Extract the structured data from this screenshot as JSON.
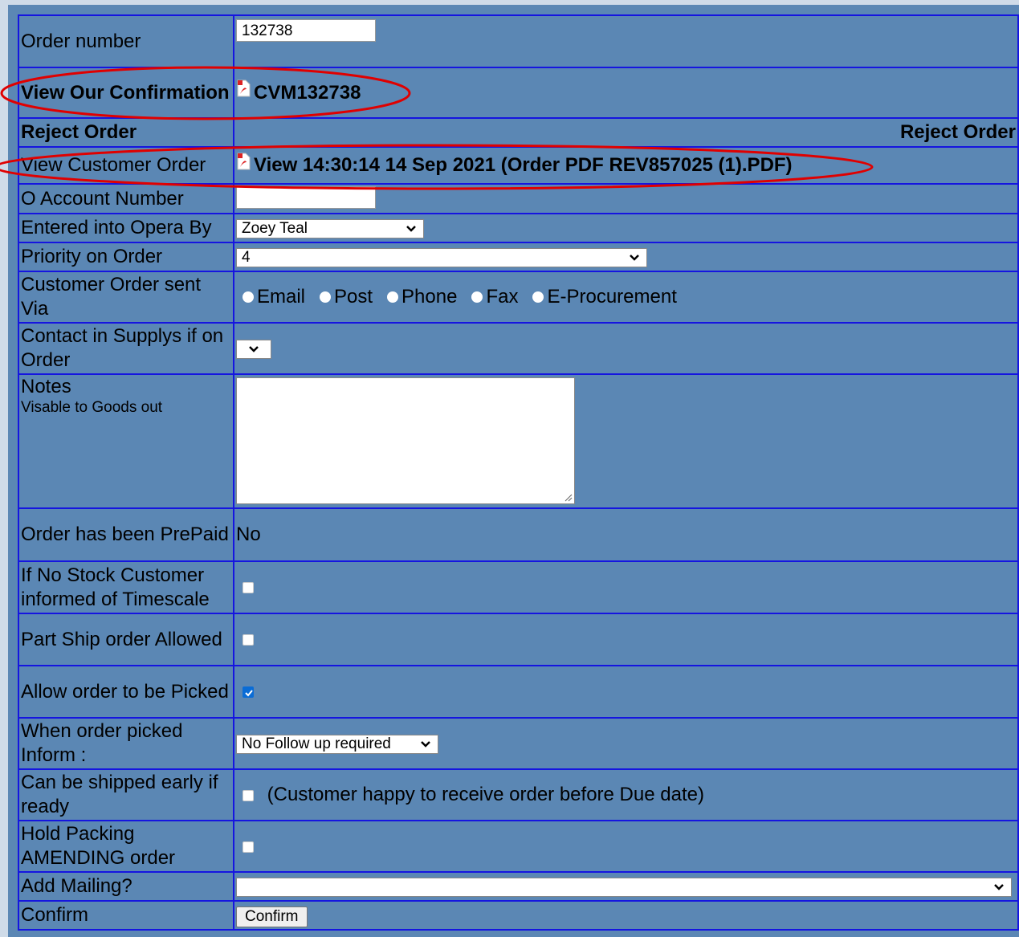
{
  "colors": {
    "panel_bg": "#5b87b4",
    "border": "#1515e0",
    "annotation": "#e00000",
    "checkbox_checked": "#0a6cd6"
  },
  "order_number": {
    "label": "Order number",
    "value": "132738"
  },
  "view_confirmation": {
    "label": "View Our Confirmation",
    "link_text": "CVM132738",
    "icon": "pdf-icon"
  },
  "reject_order": {
    "label": "Reject Order",
    "link_text": "Reject Order"
  },
  "view_customer_order": {
    "label": "View Customer Order",
    "link_text": "View 14:30:14 14 Sep 2021 (Order PDF REV857025 (1).PDF)",
    "icon": "pdf-icon"
  },
  "o_account_number": {
    "label": "O Account Number",
    "value": ""
  },
  "entered_by": {
    "label": "Entered into Opera By",
    "selected": "Zoey Teal"
  },
  "priority": {
    "label": "Priority on Order",
    "selected": "4"
  },
  "sent_via": {
    "label": "Customer Order sent Via",
    "options": [
      "Email",
      "Post",
      "Phone",
      "Fax",
      "E-Procurement"
    ]
  },
  "contact_in_supplys": {
    "label": "Contact in Supplys if on Order",
    "selected": ""
  },
  "notes": {
    "label": "Notes",
    "sublabel": "Visable to Goods out",
    "value": ""
  },
  "prepaid": {
    "label": "Order has been PrePaid",
    "value": "No"
  },
  "no_stock_informed": {
    "label": "If No Stock Customer informed of Timescale",
    "checked": false
  },
  "part_ship": {
    "label": "Part Ship order Allowed",
    "checked": false
  },
  "allow_picked": {
    "label": "Allow order to be Picked",
    "checked": true
  },
  "when_picked_inform": {
    "label": "When order picked Inform :",
    "selected": "No Follow up required"
  },
  "ship_early": {
    "label": "Can be shipped early if ready",
    "checked": false,
    "note": "(Customer happy to receive order before Due date)"
  },
  "hold_packing": {
    "label": "Hold Packing AMENDING order",
    "checked": false
  },
  "add_mailing": {
    "label": "Add Mailing?",
    "selected": ""
  },
  "confirm": {
    "label": "Confirm",
    "button": "Confirm"
  }
}
